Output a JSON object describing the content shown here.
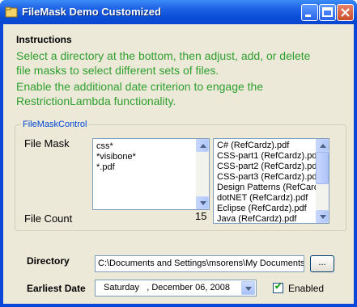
{
  "window": {
    "title": "FileMask Demo Customized",
    "colors": {
      "titlebar": "#0a4fd6",
      "client": "#ece9d8",
      "instructions_text": "#2f9f2f",
      "group_label": "#0046d5"
    }
  },
  "instructions": {
    "heading": "Instructions",
    "lines": [
      "Select a directory at the bottom, then adjust, add, or delete",
      "file masks to select different sets of files.",
      "Enable the additional date criterion to engage the",
      "RestrictionLambda functionality."
    ]
  },
  "filemask_control": {
    "group_label": "FileMaskControl",
    "file_mask_label": "File Mask",
    "masks": [
      "css*",
      "*visibone*",
      "*.pdf"
    ],
    "file_count_label": "File Count",
    "file_count": "15",
    "files": [
      "C# (RefCardz).pdf",
      "CSS-part1 (RefCardz).pdf",
      "CSS-part2 (RefCardz).pdf",
      "CSS-part3 (RefCardz).pdf",
      "Design Patterns (RefCard",
      "dotNET (RefCardz).pdf",
      "Eclipse (RefCardz).pdf",
      "Java (RefCardz).pdf"
    ]
  },
  "directory": {
    "label": "Directory",
    "value": "C:\\Documents and Settings\\msorens\\My Documents",
    "browse_label": "..."
  },
  "earliest_date": {
    "label": "Earliest Date",
    "day": "Saturday",
    "date": ", December 06, 2008",
    "enabled_label": "Enabled",
    "enabled": true
  }
}
